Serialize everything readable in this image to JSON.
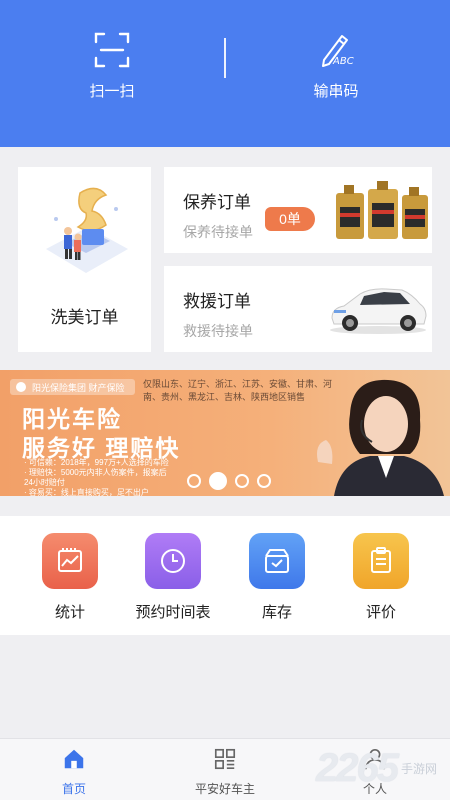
{
  "header": {
    "scan_label": "扫一扫",
    "code_label": "输串码",
    "scan_icon": "scan-icon",
    "code_icon": "pen-abc-icon",
    "accent_color": "#4b7ef0"
  },
  "cards": {
    "wash": {
      "title": "洗美订单"
    },
    "maintenance": {
      "title": "保养订单",
      "subtitle": "保养待接单",
      "badge": "0单"
    },
    "rescue": {
      "title": "救援订单",
      "subtitle": "救援待接单"
    }
  },
  "banner": {
    "logo_text": "阳光保险集团  财产保险",
    "regions": "仅限山东、辽宁、浙江、江苏、安徽、甘肃、河南、贵州、黑龙江、吉林、陕西地区销售",
    "headline1": "阳光车险",
    "headline2": "服务好 理赔快",
    "lines": [
      "· 可信赖：2018年，997万+人选择的车险",
      "· 理赔快：5000元内非人伤案件，报案后",
      "  24小时赔付",
      "· 容易买：线上直接购买，足不出户"
    ],
    "dots_total": 4,
    "dots_active": 1
  },
  "grid": [
    {
      "label": "统计",
      "icon": "chart-icon",
      "color": "#ef7357"
    },
    {
      "label": "预约时间表",
      "icon": "clock-icon",
      "color": "#9a6cf0"
    },
    {
      "label": "库存",
      "icon": "inventory-box-icon",
      "color": "#4f8cf0"
    },
    {
      "label": "评价",
      "icon": "clipboard-icon",
      "color": "#f5b534"
    }
  ],
  "tabbar": {
    "tabs": [
      {
        "label": "首页",
        "icon": "home-icon",
        "active": true
      },
      {
        "label": "平安好车主",
        "icon": "grid-icon",
        "active": false
      },
      {
        "label": "个人",
        "icon": "person-icon",
        "active": false
      }
    ],
    "active_color": "#3c74ea"
  },
  "watermark": {
    "number": "2265",
    "text": "手游网"
  }
}
